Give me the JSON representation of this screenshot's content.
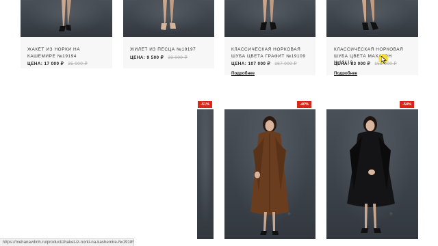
{
  "products_top": [
    {
      "title": "Жакет из норки на кашемире №19194",
      "price_label": "ЦЕНА:",
      "price": "17 000 ₽",
      "old_price": "35 000 ₽",
      "link": ""
    },
    {
      "title": "Жилет из песца №19197",
      "price_label": "ЦЕНА:",
      "price": "9 500 ₽",
      "old_price": "23 000 ₽",
      "link": ""
    },
    {
      "title": "Классическая норковая шуба цвета графит №19109",
      "price_label": "ЦЕНА:",
      "price": "107 000 ₽",
      "old_price": "167 000 ₽",
      "link": "Подробнее"
    },
    {
      "title": "Классическая норковая шуба цвета махагон №19110",
      "price_label": "ЦЕНА:",
      "price": "83 000 ₽",
      "old_price": "158 000 ₽",
      "link": "Подробнее"
    }
  ],
  "products_bottom": [
    {
      "badge": "-51%",
      "coat_color": "#3a3e44"
    },
    {
      "badge": "-40%",
      "coat_color": "#6b3d1f"
    },
    {
      "badge": "-54%",
      "coat_color": "#141416"
    }
  ],
  "status_bar": {
    "url": "https://mehanavdinh.ru/product/zhaket-iz-norki-na-kashemire-№19185/"
  },
  "colors": {
    "badge": "#d9261c",
    "photo_bg": "#42484f",
    "card_bg": "#f7f7f8"
  }
}
